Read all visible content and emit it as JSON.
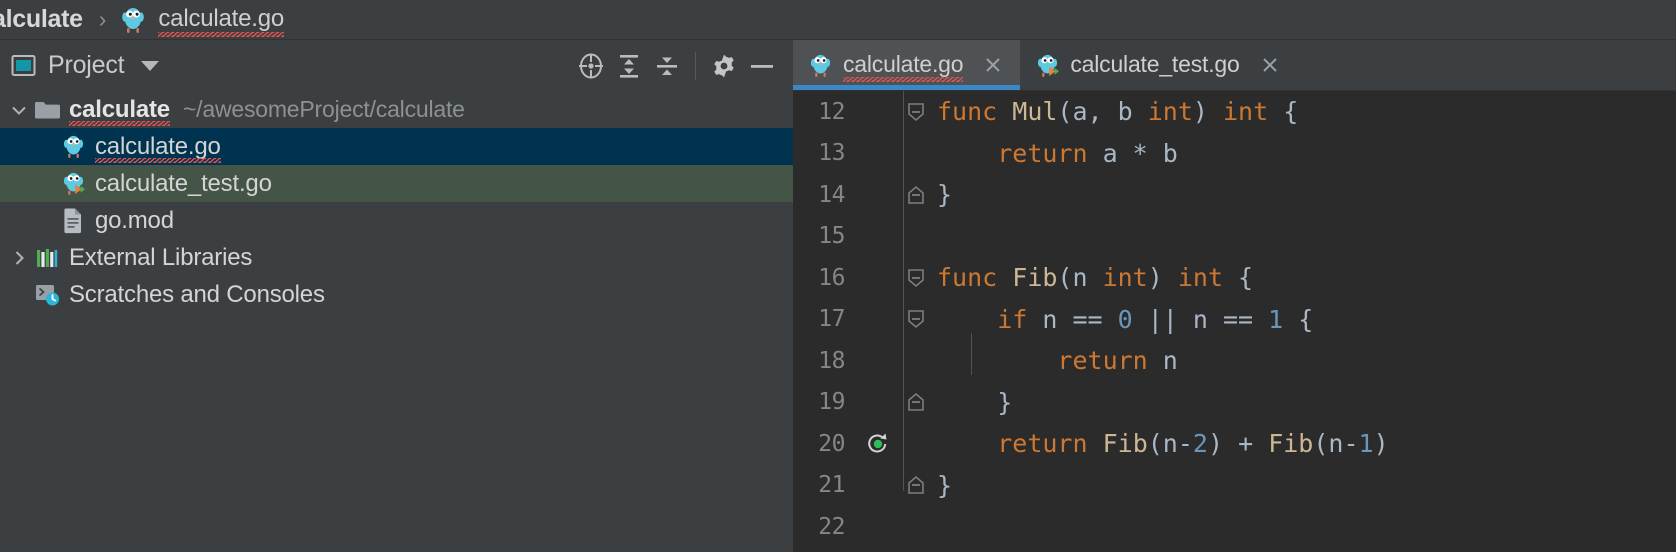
{
  "breadcrumb": {
    "items": [
      {
        "label": "alculate",
        "icon": "none",
        "bold": true,
        "misspelled": false
      },
      {
        "label": "calculate.go",
        "icon": "go-file-icon",
        "bold": false,
        "misspelled": true
      }
    ],
    "separator": "›"
  },
  "tool_window": {
    "title": "Project",
    "dropdown_icon": "chevron-down-icon",
    "panel_icon": "project-view-icon",
    "actions": [
      {
        "name": "select-opened-file-button",
        "icon": "crosshair-target-icon"
      },
      {
        "name": "expand-all-button",
        "icon": "expand-all-icon"
      },
      {
        "name": "collapse-all-button",
        "icon": "collapse-all-icon"
      },
      {
        "name": "settings-button",
        "icon": "gear-icon"
      },
      {
        "name": "hide-button",
        "icon": "minimize-icon"
      }
    ]
  },
  "tree": {
    "nodes": [
      {
        "label": "calculate",
        "secondary": "~/awesomeProject/calculate",
        "icon": "folder-icon",
        "arrow": "expanded",
        "indent": 0,
        "bold": true,
        "state": "normal",
        "misspelled": true
      },
      {
        "label": "calculate.go",
        "secondary": "",
        "icon": "go-file-icon",
        "arrow": "none",
        "indent": 1,
        "bold": false,
        "state": "selected",
        "misspelled": true
      },
      {
        "label": "calculate_test.go",
        "secondary": "",
        "icon": "go-test-file-icon",
        "arrow": "none",
        "indent": 1,
        "bold": false,
        "state": "highlighted",
        "misspelled": false
      },
      {
        "label": "go.mod",
        "secondary": "",
        "icon": "go-mod-file-icon",
        "arrow": "none",
        "indent": 1,
        "bold": false,
        "state": "normal",
        "misspelled": false
      },
      {
        "label": "External Libraries",
        "secondary": "",
        "icon": "libraries-icon",
        "arrow": "collapsed",
        "indent": 0,
        "bold": false,
        "state": "normal",
        "misspelled": false
      },
      {
        "label": "Scratches and Consoles",
        "secondary": "",
        "icon": "scratches-icon",
        "arrow": "none",
        "indent": 0,
        "bold": false,
        "state": "normal",
        "misspelled": false
      }
    ]
  },
  "editor": {
    "tabs": [
      {
        "label": "calculate.go",
        "icon": "go-file-icon",
        "active": true,
        "misspelled": true,
        "close_icon": "close-icon"
      },
      {
        "label": "calculate_test.go",
        "icon": "go-test-file-icon",
        "active": false,
        "misspelled": false,
        "close_icon": "close-icon"
      }
    ],
    "language": "go",
    "lines": [
      {
        "number": "12",
        "fold": "open-start",
        "gutter": "",
        "tokens": [
          {
            "t": "func ",
            "c": "kw"
          },
          {
            "t": "Mul",
            "c": "fn"
          },
          {
            "t": "(a, b ",
            "c": "pl"
          },
          {
            "t": "int",
            "c": "kw"
          },
          {
            "t": ") ",
            "c": "pl"
          },
          {
            "t": "int",
            "c": "kw"
          },
          {
            "t": " {",
            "c": "pl"
          }
        ],
        "text": "func Mul(a, b int) int {"
      },
      {
        "number": "13",
        "fold": "",
        "gutter": "",
        "tokens": [
          {
            "t": "    ",
            "c": "pl"
          },
          {
            "t": "return",
            "c": "kw"
          },
          {
            "t": " a * b",
            "c": "pl"
          }
        ],
        "text": "    return a * b"
      },
      {
        "number": "14",
        "fold": "open-end",
        "gutter": "",
        "tokens": [
          {
            "t": "}",
            "c": "pl"
          }
        ],
        "text": "}"
      },
      {
        "number": "15",
        "fold": "",
        "gutter": "",
        "tokens": [],
        "text": ""
      },
      {
        "number": "16",
        "fold": "open-start",
        "gutter": "",
        "tokens": [
          {
            "t": "func ",
            "c": "kw"
          },
          {
            "t": "Fib",
            "c": "fn"
          },
          {
            "t": "(n ",
            "c": "pl"
          },
          {
            "t": "int",
            "c": "kw"
          },
          {
            "t": ") ",
            "c": "pl"
          },
          {
            "t": "int",
            "c": "kw"
          },
          {
            "t": " {",
            "c": "pl"
          }
        ],
        "text": "func Fib(n int) int {"
      },
      {
        "number": "17",
        "fold": "open-start-inner",
        "gutter": "",
        "tokens": [
          {
            "t": "    ",
            "c": "pl"
          },
          {
            "t": "if",
            "c": "kw"
          },
          {
            "t": " n == ",
            "c": "pl"
          },
          {
            "t": "0",
            "c": "num"
          },
          {
            "t": " || n == ",
            "c": "pl"
          },
          {
            "t": "1",
            "c": "num"
          },
          {
            "t": " {",
            "c": "pl"
          }
        ],
        "text": "    if n == 0 || n == 1 {"
      },
      {
        "number": "18",
        "fold": "",
        "gutter": "",
        "tokens": [
          {
            "t": "        ",
            "c": "pl"
          },
          {
            "t": "return",
            "c": "kw"
          },
          {
            "t": " n",
            "c": "pl"
          }
        ],
        "text": "        return n"
      },
      {
        "number": "19",
        "fold": "open-end-inner",
        "gutter": "",
        "tokens": [
          {
            "t": "    }",
            "c": "pl"
          }
        ],
        "text": "    }"
      },
      {
        "number": "20",
        "fold": "",
        "gutter": "recursive-call-icon",
        "tokens": [
          {
            "t": "    ",
            "c": "pl"
          },
          {
            "t": "return",
            "c": "kw"
          },
          {
            "t": " ",
            "c": "pl"
          },
          {
            "t": "Fib",
            "c": "fn"
          },
          {
            "t": "(n-",
            "c": "pl"
          },
          {
            "t": "2",
            "c": "num"
          },
          {
            "t": ") + ",
            "c": "pl"
          },
          {
            "t": "Fib",
            "c": "fn"
          },
          {
            "t": "(n-",
            "c": "pl"
          },
          {
            "t": "1",
            "c": "num"
          },
          {
            "t": ")",
            "c": "pl"
          }
        ],
        "text": "    return Fib(n-2) + Fib(n-1)"
      },
      {
        "number": "21",
        "fold": "open-end",
        "gutter": "",
        "tokens": [
          {
            "t": "}",
            "c": "pl"
          }
        ],
        "text": "}"
      },
      {
        "number": "22",
        "fold": "",
        "gutter": "",
        "tokens": [],
        "text": ""
      }
    ]
  },
  "colors": {
    "panel_bg": "#3c3f41",
    "editor_bg": "#2b2b2b",
    "selection_blue": "#00334f",
    "selection_green": "#445446",
    "tab_active_bg": "#4e5254",
    "tab_underline": "#3a88c8",
    "keyword_orange": "#cc7832",
    "function_tan": "#cbb793",
    "number_blue": "#6897bb",
    "plain_text": "#a9b7c6",
    "gutter_text": "#868686",
    "error_red": "#e05252",
    "run_green": "#2dbd58"
  }
}
